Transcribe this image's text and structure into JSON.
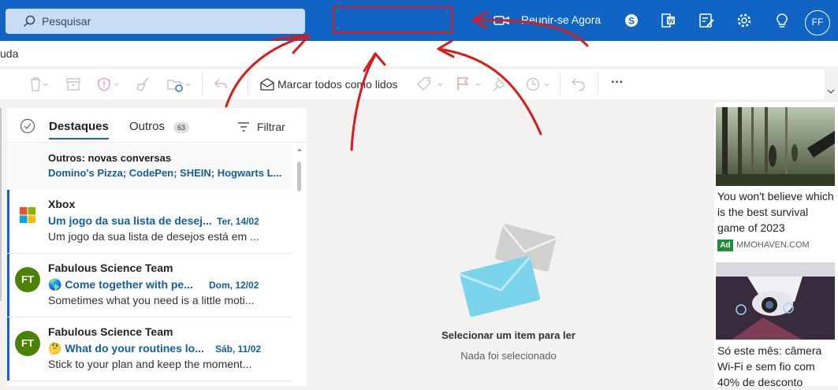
{
  "colors": {
    "brand": "#0f64c4",
    "annotation": "#e31b1b",
    "ad_badge": "#1e8e3e",
    "avatar_bg": "#498205"
  },
  "search": {
    "placeholder": "Pesquisar",
    "icon": "search-icon"
  },
  "header": {
    "meet_now_label": "Reunir-se Agora",
    "icons": [
      "video-icon",
      "skype-icon",
      "office-icon",
      "todo-icon",
      "gear-icon",
      "lightbulb-icon"
    ],
    "avatar_initials": "FF"
  },
  "menu": {
    "help_label": "uda"
  },
  "toolbar": {
    "icons": [
      "delete-icon",
      "archive-icon",
      "report-icon",
      "sweep-icon",
      "move-icon",
      "reply-icon",
      "tag-icon",
      "flag-icon",
      "pin-icon",
      "snooze-icon",
      "undo-icon",
      "more-icon"
    ],
    "mark_all_read_label": "Marcar todos como lidos",
    "more_label": "···"
  },
  "pivot": {
    "focused_label": "Destaques",
    "other_label": "Outros",
    "other_count": "63",
    "filter_label": "Filtrar"
  },
  "others_notice": {
    "title": "Outros: novas conversas",
    "senders": "Domino's Pizza; CodePen; SHEIN; Hogwarts L..."
  },
  "messages": [
    {
      "sender": "Xbox",
      "subject": "Um jogo da sua lista de desej...",
      "date": "Ter, 14/02",
      "preview": "Um jogo da sua lista de desejos está em ...",
      "avatar": "xbox-logo"
    },
    {
      "sender": "Fabulous Science Team",
      "subject": "🌎 Come together with pe...",
      "date": "Dom, 12/02",
      "preview": "Sometimes what you need is a little moti...",
      "avatar": "FT"
    },
    {
      "sender": "Fabulous Science Team",
      "subject": "🤔 What do your routines lo...",
      "date": "Sáb, 11/02",
      "preview": "Stick to your plan and keep the moment...",
      "avatar": "FT"
    }
  ],
  "reading_pane": {
    "title": "Selecionar um item para ler",
    "subtitle": "Nada foi selecionado"
  },
  "ads": [
    {
      "text": "You won't believe which is the best survival game of 2023",
      "badge": "Ad",
      "domain": "MMOHAVEN.COM"
    },
    {
      "text": "Só este mês: câmera Wi-Fi e sem fio com 40% de desconto"
    }
  ]
}
